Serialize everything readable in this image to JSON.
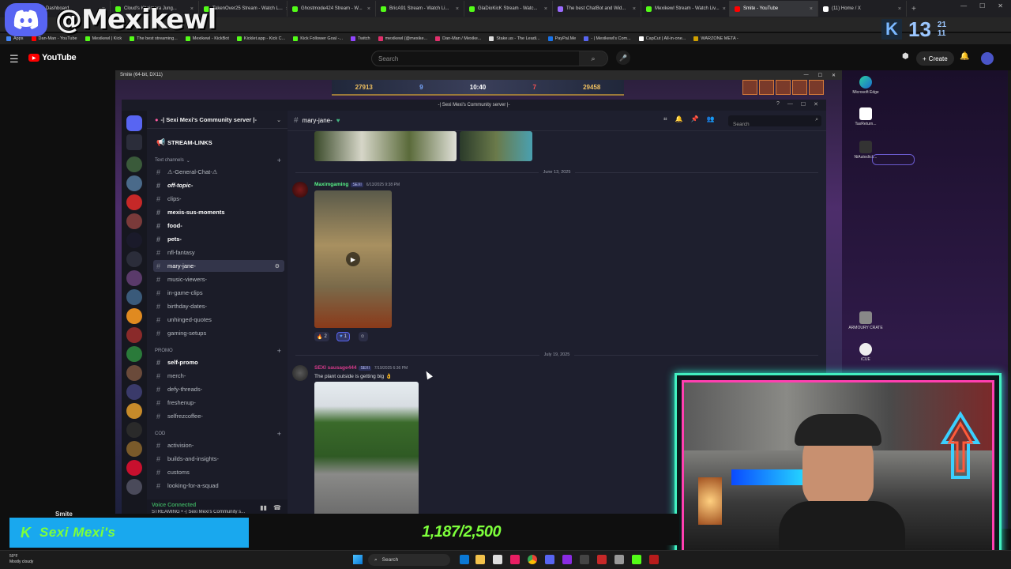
{
  "browser": {
    "tabs": [
      {
        "label": "Kick Dashboard",
        "active": false
      },
      {
        "label": "Cloud's Khaimera Jung...",
        "active": false
      },
      {
        "label": "TakenOver25 Stream - Watch L...",
        "active": false
      },
      {
        "label": "Ghostmode424 Stream - W...",
        "active": false
      },
      {
        "label": "BricA91 Stream - Watch Li...",
        "active": false
      },
      {
        "label": "GlaDioKicK Stream - Watc...",
        "active": false
      },
      {
        "label": "The best ChatBot and Wid...",
        "active": false
      },
      {
        "label": "Mexikewl Stream - Watch Liv...",
        "active": false
      },
      {
        "label": "Smite - YouTube",
        "active": true
      },
      {
        "label": "(11) Home / X",
        "active": false
      }
    ],
    "new_tab": "+",
    "bookmarks": [
      "Apps",
      "Dan-Man - YouTube",
      "Mexikewl | Kick",
      "The best streaming...",
      "Mexikewl - KickBot",
      "Kicklet.app - Kick C...",
      "Kick Follower Goal -...",
      "Twitch",
      "mexikewl (@mexike...",
      "Dan-Man / Mexike...",
      "Stake.us - The Leadi...",
      "PayPal.Me",
      "- | Mexikewl's Com...",
      "CapCut | All-in-one...",
      "WARZONE META -"
    ]
  },
  "overlay": {
    "handle": "@Mexikewl",
    "kick_letter": "K",
    "kick_count": "13",
    "kick_side_top": "21",
    "kick_side_bottom": "11"
  },
  "youtube": {
    "logo": "YouTube",
    "search_placeholder": "Search",
    "create_label": "Create"
  },
  "smite": {
    "window_title": "Smite (64-bit, DX11)",
    "gold_left": "27913",
    "kills_blue": "9",
    "time": "10:40",
    "kills_red": "7",
    "gold_right": "29458"
  },
  "discord": {
    "window_title": "-| Sexi Mexi's Community server |-",
    "server_name": "-| Sexi Mexi's Community server |-",
    "top_channel": "STREAM-LINKS",
    "categories": {
      "text": "Text channels",
      "promo": "PROMO",
      "cod": "COD"
    },
    "channels": [
      {
        "name": "⚠-General-Chat-⚠",
        "bold": false
      },
      {
        "name": "off-topic-",
        "bold": true
      },
      {
        "name": "clips-",
        "bold": false
      },
      {
        "name": "mexis-sus-moments",
        "bold": true
      },
      {
        "name": "food-",
        "bold": true
      },
      {
        "name": "pets-",
        "bold": true
      },
      {
        "name": "nfl-fantasy",
        "bold": false
      },
      {
        "name": "mary-jane-",
        "bold": false,
        "active": true
      },
      {
        "name": "music-viewers-",
        "bold": false
      },
      {
        "name": "in-game-clips",
        "bold": false
      },
      {
        "name": "birthday-dates-",
        "bold": false
      },
      {
        "name": "unhinged-quotes",
        "bold": false
      },
      {
        "name": "gaming-setups",
        "bold": false
      }
    ],
    "promo_channels": [
      {
        "name": "self-promo",
        "bold": true
      },
      {
        "name": "merch-",
        "bold": false
      },
      {
        "name": "defy-threads-",
        "bold": false
      },
      {
        "name": "freshenup-",
        "bold": false
      },
      {
        "name": "selfrezcoffee-",
        "bold": false
      }
    ],
    "cod_channels": [
      {
        "name": "activision-",
        "bold": false
      },
      {
        "name": "builds-and-insights-",
        "bold": false
      },
      {
        "name": "customs",
        "bold": false
      },
      {
        "name": "looking-for-a-squad",
        "bold": false
      }
    ],
    "voice": {
      "status": "Voice Connected",
      "channel": "STREAMING • -| Sexi Mexi's Community s..."
    },
    "chat": {
      "channel": "mary-jane-",
      "search_placeholder": "Search",
      "date1": "June 13, 2025",
      "msg1_author": "Maximgaming",
      "msg1_tag": "SEXI",
      "msg1_time": "6/13/2025 9:38 PM",
      "reaction1_count": "2",
      "reaction2_count": "1",
      "date2": "July 19, 2025",
      "msg2_author": "SEXI sausage444",
      "msg2_tag": "SEXI",
      "msg2_time": "7/19/2025 6:36 PM",
      "msg2_text": "The plant outside is getting big"
    }
  },
  "desktop_icons": [
    "Microsoft Edge",
    "TaxReturn...",
    "NiAutoclick...",
    "ARMOURY CRATE",
    "iCUE"
  ],
  "bottom_overlay": {
    "game_label": "Smite",
    "sub_k": "K",
    "sub_text": "Sexi Mexi's",
    "goal": "1,187/2,500"
  },
  "taskbar": {
    "weather_temp": "50°F",
    "weather_desc": "Mostly cloudy",
    "search_label": "Search"
  },
  "colors": {
    "kick_green": "#53fc18",
    "discord_blurple": "#5865f2",
    "youtube_red": "#ff0000",
    "goal_green": "#7dff3b",
    "webcam_border": "#42f0c0"
  }
}
